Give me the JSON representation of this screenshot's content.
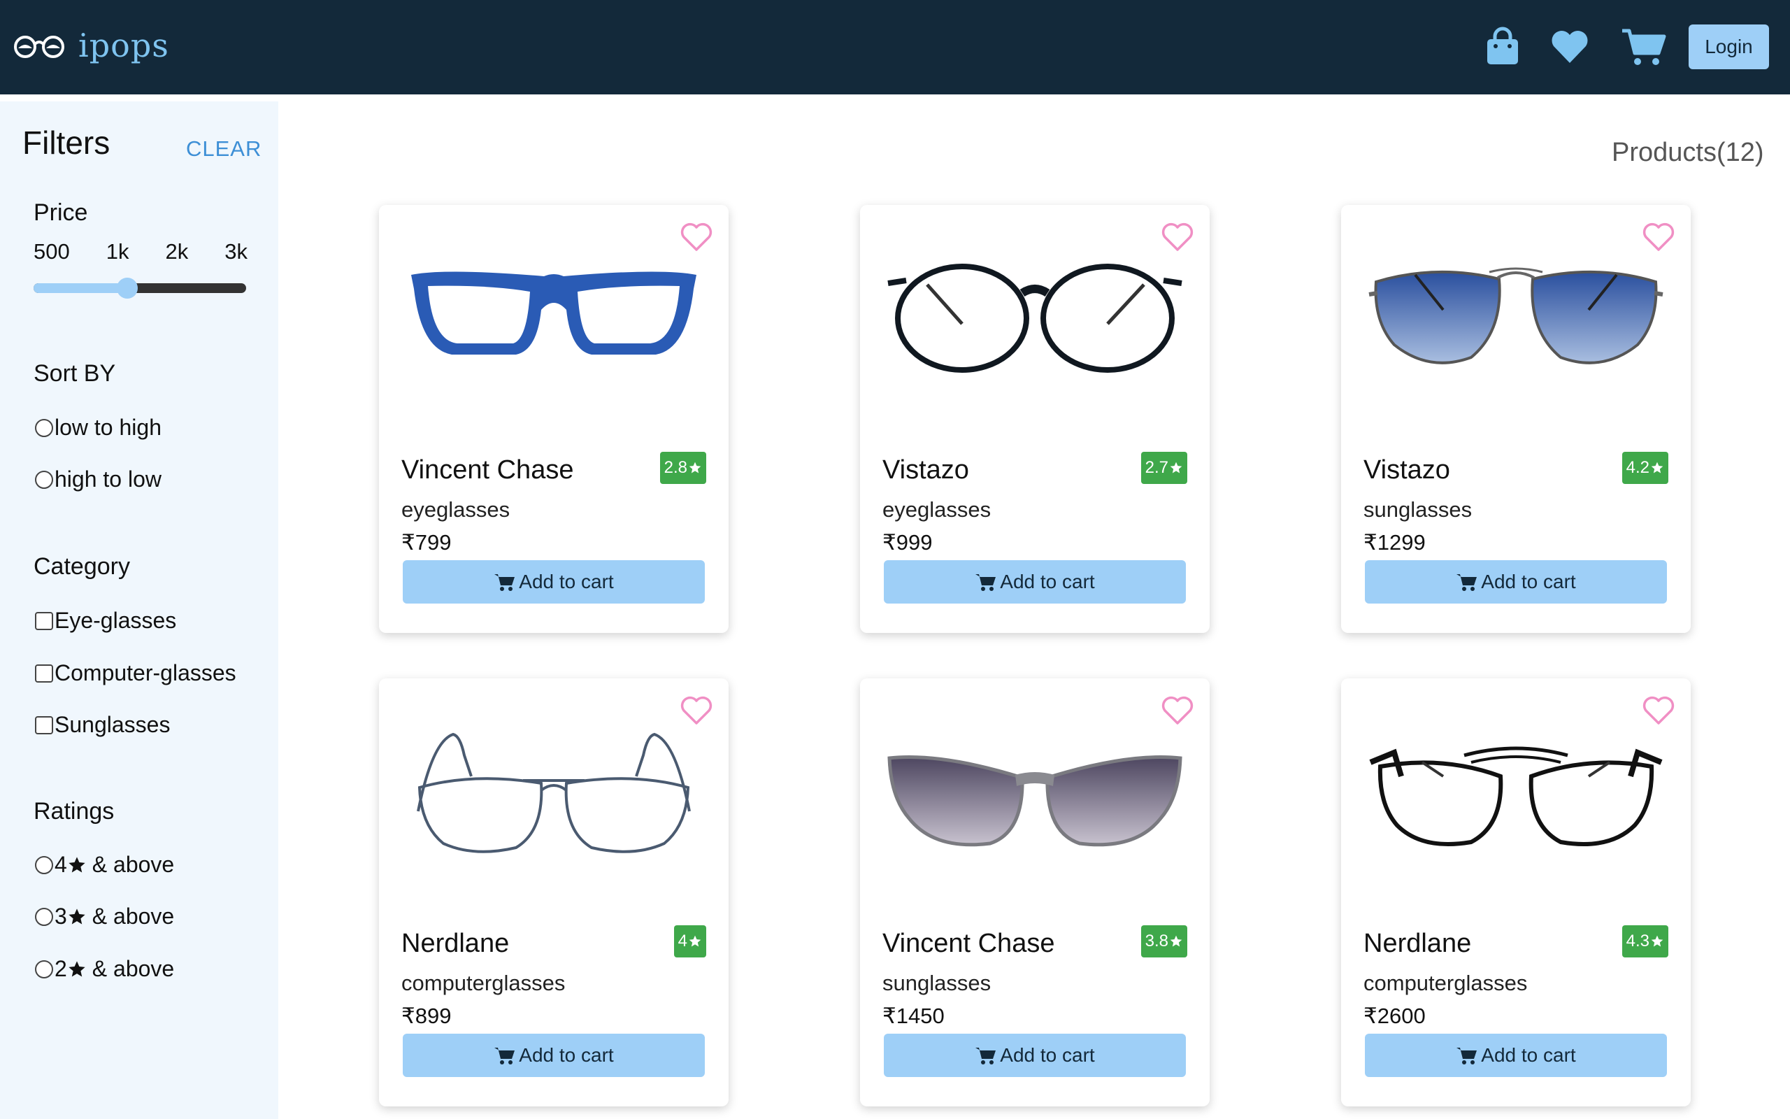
{
  "header": {
    "brand": "ipops",
    "icons": [
      "bag-icon",
      "heart-icon",
      "cart-icon"
    ],
    "login_label": "Login"
  },
  "sidebar": {
    "title": "Filters",
    "clear_label": "CLEAR",
    "price": {
      "title": "Price",
      "ticks": [
        "500",
        "1k",
        "2k",
        "3k"
      ],
      "slider_value": 0.44
    },
    "sort": {
      "title": "Sort BY",
      "options": [
        "low to high",
        "high to low"
      ]
    },
    "category": {
      "title": "Category",
      "options": [
        "Eye-glasses",
        "Computer-glasses",
        "Sunglasses"
      ]
    },
    "ratings": {
      "title": "Ratings",
      "options": [
        {
          "value": "4",
          "suffix": "& above"
        },
        {
          "value": "3",
          "suffix": "& above"
        },
        {
          "value": "2",
          "suffix": "& above"
        }
      ]
    }
  },
  "main": {
    "products_count": "Products(12)",
    "add_to_cart_label": "Add to cart",
    "products": [
      {
        "name": "Vincent Chase",
        "rating": "2.8",
        "category": "eyeglasses",
        "price": "₹799"
      },
      {
        "name": "Vistazo",
        "rating": "2.7",
        "category": "eyeglasses",
        "price": "₹999"
      },
      {
        "name": "Vistazo",
        "rating": "4.2",
        "category": "sunglasses",
        "price": "₹1299"
      },
      {
        "name": "Nerdlane",
        "rating": "4",
        "category": "computerglasses",
        "price": "₹899"
      },
      {
        "name": "Vincent Chase",
        "rating": "3.8",
        "category": "sunglasses",
        "price": "₹1450"
      },
      {
        "name": "Nerdlane",
        "rating": "4.3",
        "category": "computerglasses",
        "price": "₹2600"
      }
    ]
  },
  "colors": {
    "header_bg": "#13293a",
    "accent": "#9ecff7",
    "sidebar_bg": "#f0f7fd",
    "rating_green": "#3fa84a",
    "heart_pink": "#f08fc4"
  }
}
